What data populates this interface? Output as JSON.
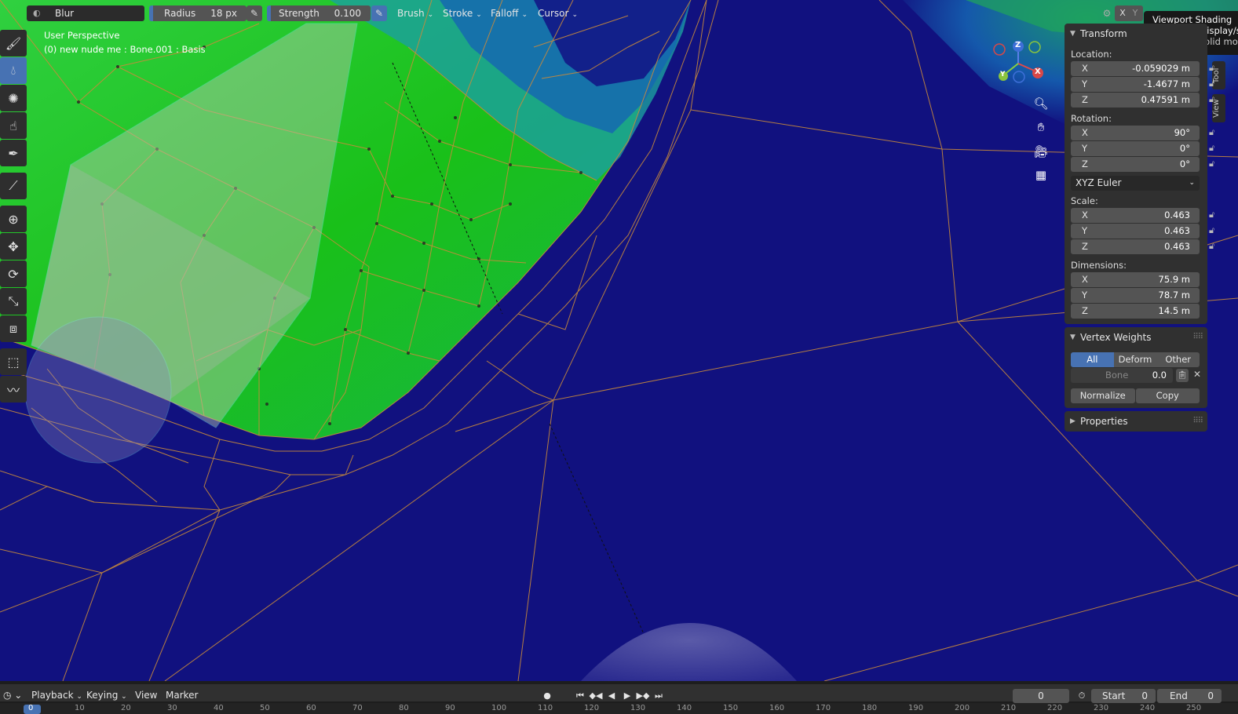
{
  "header": {
    "brush_name": "Blur",
    "radius_label": "Radius",
    "radius_value": "18 px",
    "strength_label": "Strength",
    "strength_value": "0.100",
    "menus": [
      "Brush",
      "Stroke",
      "Falloff",
      "Cursor"
    ],
    "axis_x": "X",
    "axis_y": "Y"
  },
  "viewport": {
    "perspective_label": "User Perspective",
    "object_info": "(0) new nude me : Bone.001 : Basis",
    "gizmo_axes": {
      "x": "X",
      "y": "Y",
      "z": "Z"
    }
  },
  "tooltip": {
    "title": "Viewport Shading",
    "line1": "Method to display/sh",
    "line2": "Display in solid mod"
  },
  "toolbar": {
    "tools": [
      "draw-tool-icon",
      "blur-tool-icon",
      "average-tool-icon",
      "smear-tool-icon",
      "sample-weight-icon",
      "gradient-tool-icon",
      "cursor-tool-icon",
      "move-tool-icon",
      "rotate-tool-icon",
      "scale-tool-icon",
      "transform-tool-icon",
      "select-box-icon",
      "annotate-tool-icon"
    ]
  },
  "side_tabs": [
    "Tool",
    "View"
  ],
  "transform_panel": {
    "title": "Transform",
    "location_label": "Location:",
    "location": [
      {
        "axis": "X",
        "value": "-0.059029 m"
      },
      {
        "axis": "Y",
        "value": "-1.4677 m"
      },
      {
        "axis": "Z",
        "value": "0.47591 m"
      }
    ],
    "rotation_label": "Rotation:",
    "rotation": [
      {
        "axis": "X",
        "value": "90°"
      },
      {
        "axis": "Y",
        "value": "0°"
      },
      {
        "axis": "Z",
        "value": "0°"
      }
    ],
    "rotation_mode": "XYZ Euler",
    "scale_label": "Scale:",
    "scale": [
      {
        "axis": "X",
        "value": "0.463"
      },
      {
        "axis": "Y",
        "value": "0.463"
      },
      {
        "axis": "Z",
        "value": "0.463"
      }
    ],
    "dimensions_label": "Dimensions:",
    "dimensions": [
      {
        "axis": "X",
        "value": "75.9 m"
      },
      {
        "axis": "Y",
        "value": "78.7 m"
      },
      {
        "axis": "Z",
        "value": "14.5 m"
      }
    ]
  },
  "vertex_weights_panel": {
    "title": "Vertex Weights",
    "filters": [
      "All",
      "Deform",
      "Other"
    ],
    "bone_label": "Bone",
    "bone_value": "0.0",
    "normalize_label": "Normalize",
    "copy_label": "Copy"
  },
  "properties_panel": {
    "title": "Properties"
  },
  "timeline": {
    "menus": [
      "Playback",
      "Keying",
      "View",
      "Marker"
    ],
    "current_frame": "0",
    "start_label": "Start",
    "start_value": "0",
    "end_label": "End",
    "end_value": "0",
    "ruler_ticks": [
      "0",
      "10",
      "20",
      "30",
      "40",
      "50",
      "60",
      "70",
      "80",
      "90",
      "100",
      "110",
      "120",
      "130",
      "140",
      "150",
      "160",
      "170",
      "180",
      "190",
      "200",
      "210",
      "220",
      "230",
      "240",
      "250"
    ]
  },
  "colors": {
    "viewport_bg": "#11117f",
    "weight_green": "#22c422",
    "wire": "#c88a3c",
    "accent_blue": "#4772b3",
    "panel_bg": "#303030"
  }
}
